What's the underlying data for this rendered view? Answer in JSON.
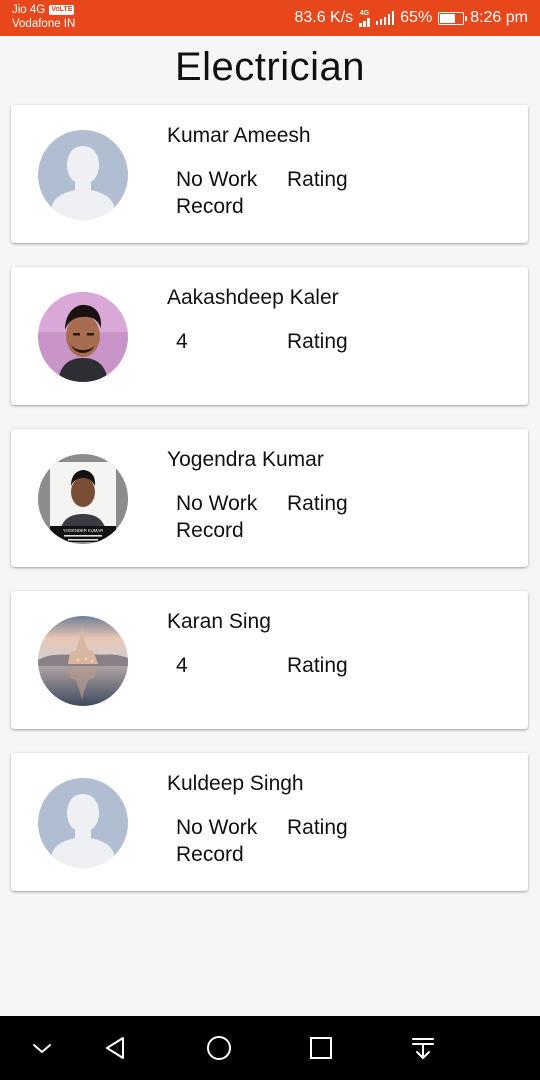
{
  "status_bar": {
    "carrier_1": "Jio 4G",
    "volte_badge": "VoLTE",
    "carrier_2": "Vodafone IN",
    "speed": "83.6 K/s",
    "network_type": "4G",
    "battery": "65%",
    "time": "8:26 pm",
    "background_color": "#e8471c"
  },
  "page_title": "Electrician",
  "electricians": [
    {
      "name": "Kumar Ameesh",
      "work_count": "No Work Record",
      "rating_label": "Rating",
      "avatar": "default-person-icon"
    },
    {
      "name": "Aakashdeep Kaler",
      "work_count": "4",
      "rating_label": "Rating",
      "avatar": "profile-photo"
    },
    {
      "name": "Yogendra Kumar",
      "work_count": "No Work Record",
      "rating_label": "Rating",
      "avatar": "profile-photo",
      "photo_caption": "YOGENDER KUMAR"
    },
    {
      "name": "Karan Sing",
      "work_count": "4",
      "rating_label": "Rating",
      "avatar": "lake-castle-photo"
    },
    {
      "name": "Kuldeep Singh",
      "work_count": "No Work Record",
      "rating_label": "Rating",
      "avatar": "default-person-icon"
    }
  ],
  "nav_bar": {
    "buttons": [
      "hide-nav-icon",
      "back-icon",
      "home-icon",
      "recents-icon",
      "notification-pull-icon"
    ]
  }
}
